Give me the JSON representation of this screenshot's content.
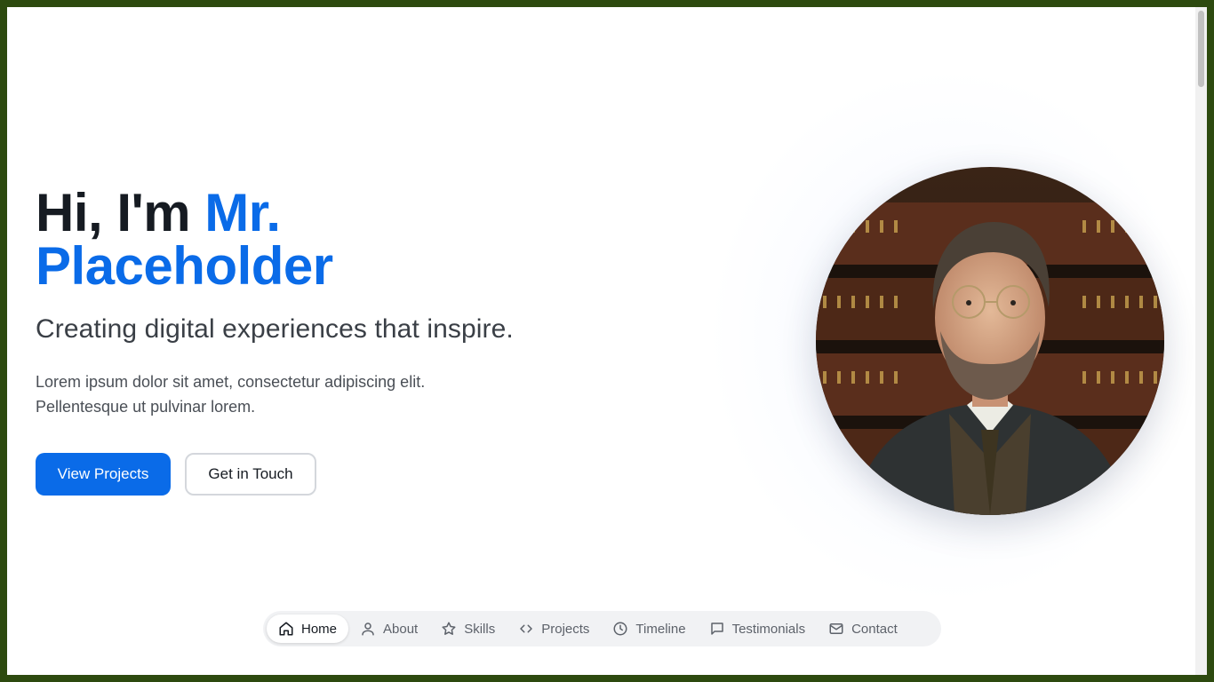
{
  "hero": {
    "greeting": "Hi, I'm ",
    "name_first": "Mr.",
    "name_last": "Placeholder",
    "subtitle": "Creating digital experiences that inspire.",
    "desc_line1": "Lorem ipsum dolor sit amet, consectetur adipiscing elit.",
    "desc_line2": "Pellentesque ut pulvinar lorem."
  },
  "buttons": {
    "primary": "View Projects",
    "secondary": "Get in Touch"
  },
  "nav": {
    "items": [
      {
        "label": "Home",
        "icon": "home-icon",
        "active": true
      },
      {
        "label": "About",
        "icon": "user-icon",
        "active": false
      },
      {
        "label": "Skills",
        "icon": "star-icon",
        "active": false
      },
      {
        "label": "Projects",
        "icon": "code-icon",
        "active": false
      },
      {
        "label": "Timeline",
        "icon": "clock-icon",
        "active": false
      },
      {
        "label": "Testimonials",
        "icon": "message-icon",
        "active": false
      },
      {
        "label": "Contact",
        "icon": "mail-icon",
        "active": false
      }
    ]
  },
  "colors": {
    "accent": "#0a6be8",
    "text_dark": "#161b22",
    "frame": "#2d4a0f"
  }
}
